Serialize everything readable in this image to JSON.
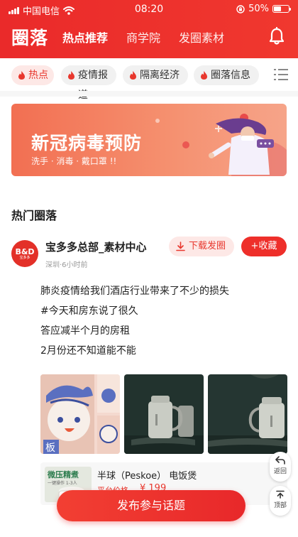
{
  "status_bar": {
    "carrier": "中国电信",
    "time": "08:20",
    "battery": "50%",
    "battery_level": 0.5
  },
  "header": {
    "logo": "圈落",
    "tabs": [
      {
        "label": "热点推荐"
      },
      {
        "label": "商学院"
      },
      {
        "label": "发圈素材"
      }
    ],
    "active_tab": "热点推荐",
    "notification_icon": "bell-icon"
  },
  "categories": {
    "items": [
      {
        "label": "热点"
      },
      {
        "label": "疫情报道"
      },
      {
        "label": "隔离经济"
      },
      {
        "label": "圈落信息"
      }
    ],
    "active": "热点",
    "menu_icon": "list-icon"
  },
  "banner": {
    "title": "新冠病毒预防",
    "subtitle": "洗手 · 消毒 · 戴口罩 !!"
  },
  "section": {
    "title": "热门圈落"
  },
  "post": {
    "author": "宝多多总部_素材中心",
    "avatar_text": "B&D",
    "avatar_sub": "宝多多",
    "location": "深圳",
    "time_ago": "6小时前",
    "meta": "深圳·6小时前",
    "download_label": "下载发圈",
    "favorite_label": "+收藏",
    "lines": [
      "肺炎疫情给我们酒店行业带来了不少的损失",
      "#今天和房东说了很久",
      "答应减半个月的房租",
      "2月份还不知道能不能"
    ],
    "product": {
      "name": "半球（Peskoe） 电饭煲",
      "price_label": "平台价格",
      "price": "¥ 199",
      "image_title": "微压精煮",
      "image_sub": "一键操作 1-3人"
    }
  },
  "floating": {
    "back_label": "返回",
    "top_label": "顶部"
  },
  "publish_button": "发布参与话题",
  "colors": {
    "brand_red": "#ea2a2a",
    "chip_active_bg": "#fde8e6",
    "banner_start": "#f26f52",
    "banner_end": "#f6a489"
  }
}
